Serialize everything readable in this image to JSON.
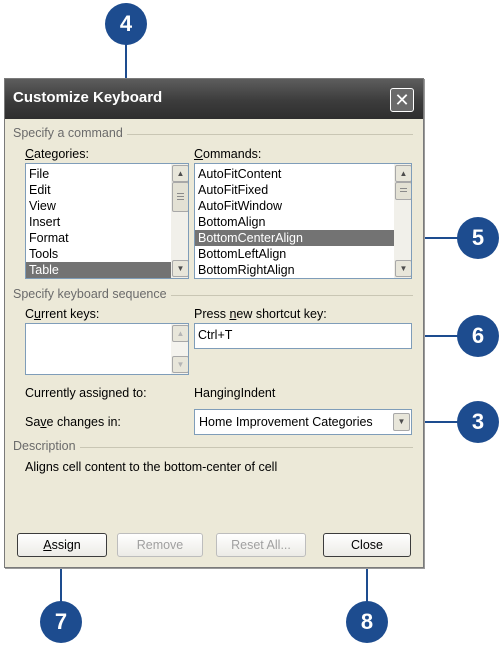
{
  "dialog": {
    "title": "Customize Keyboard",
    "close_glyph": "✕",
    "specify_command_group": "Specify a command",
    "categories_label_u": "C",
    "categories_label_rest": "ategories:",
    "categories": [
      "File",
      "Edit",
      "View",
      "Insert",
      "Format",
      "Tools",
      "Table"
    ],
    "categories_selected": "Table",
    "commands_label_u": "C",
    "commands_label_rest": "ommands:",
    "commands": [
      "AutoFitContent",
      "AutoFitFixed",
      "AutoFitWindow",
      "BottomAlign",
      "BottomCenterAlign",
      "BottomLeftAlign",
      "BottomRightAlign"
    ],
    "commands_selected": "BottomCenterAlign",
    "keyboard_group": "Specify keyboard sequence",
    "current_keys_label_u": "u",
    "current_keys_label_pre": "C",
    "current_keys_label_post": "rrent keys:",
    "shortcut_label_pre": "Press ",
    "shortcut_label_u": "n",
    "shortcut_label_post": "ew shortcut key:",
    "shortcut_value": "Ctrl+T",
    "assigned_label": "Currently assigned to:",
    "assigned_value": "HangingIndent",
    "save_label_pre": "Sa",
    "save_label_u": "v",
    "save_label_post": "e changes in:",
    "save_value": "Home Improvement Categories",
    "description_group": "Description",
    "description_text": "Aligns cell content to the bottom-center of cell",
    "buttons": {
      "assign_u": "A",
      "assign_rest": "ssign",
      "remove": "Remove",
      "reset_all": "Reset All...",
      "close": "Close"
    }
  },
  "callouts": [
    "4",
    "5",
    "6",
    "3",
    "7",
    "8"
  ],
  "colors": {
    "callout": "#1d4c8f",
    "selection": "#737373",
    "dialog_bg": "#ece9d8"
  }
}
